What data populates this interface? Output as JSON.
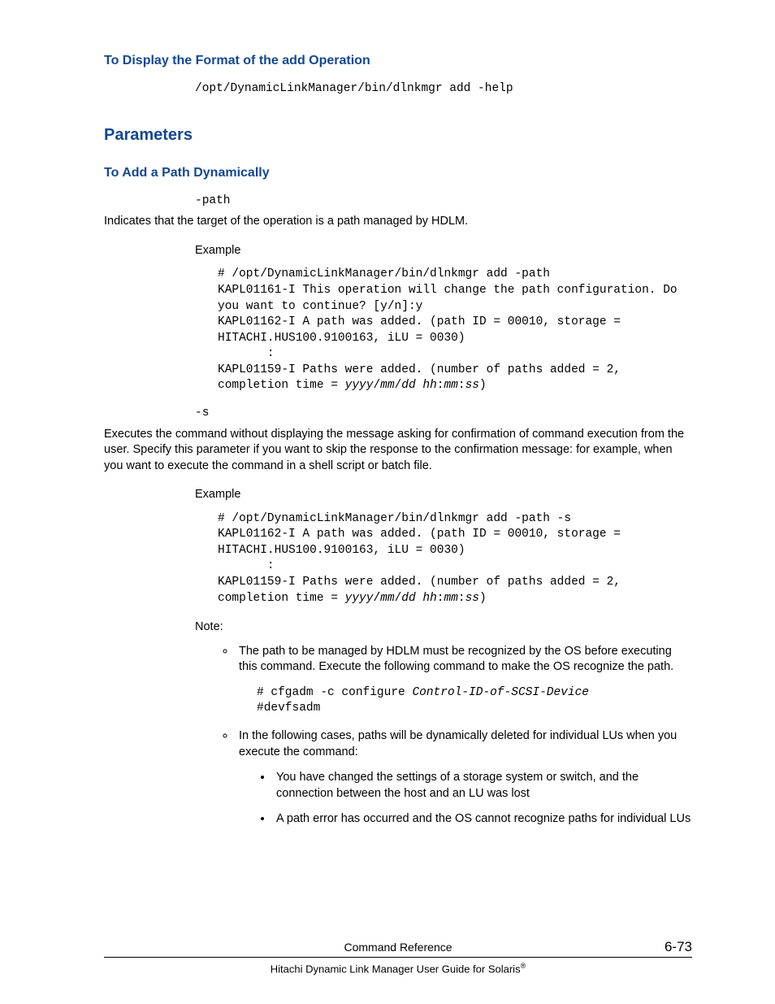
{
  "headings": {
    "h3_format": "To Display the Format of the add Operation",
    "h2_params": "Parameters",
    "h3_addpath": "To Add a Path Dynamically"
  },
  "code": {
    "help_cmd": "/opt/DynamicLinkManager/bin/dlnkmgr add -help",
    "path_term": "-path",
    "path_desc": "Indicates that the target of the operation is a path managed by HDLM.",
    "example_label": "Example",
    "ex1_l1": "# /opt/DynamicLinkManager/bin/dlnkmgr add -path",
    "ex1_l2": "KAPL01161-I This operation will change the path configuration. Do you want to continue? [y/n]:y",
    "ex1_l3": "KAPL01162-I A path was added. (path ID = 00010, storage = HITACHI.HUS100.9100163, iLU = 0030)",
    "ex1_l4": "       :",
    "ex1_l5a": "KAPL01159-I Paths were added. (number of paths added = 2, completion time = ",
    "ex1_l5b": "yyyy",
    "ex1_l5c": "/",
    "ex1_l5d": "mm",
    "ex1_l5e": "/",
    "ex1_l5f": "dd",
    "ex1_l5g": " ",
    "ex1_l5h": "hh",
    "ex1_l5i": ":",
    "ex1_l5j": "mm",
    "ex1_l5k": ":",
    "ex1_l5l": "ss",
    "ex1_l5m": ")",
    "s_term": "-s",
    "s_desc": "Executes the command without displaying the message asking for confirmation of command execution from the user. Specify this parameter if you want to skip the response to the confirmation message: for example, when you want to execute the command in a shell script or batch file.",
    "ex2_l1": "# /opt/DynamicLinkManager/bin/dlnkmgr add -path -s",
    "ex2_l2": "KAPL01162-I A path was added. (path ID = 00010, storage = HITACHI.HUS100.9100163, iLU = 0030)",
    "ex2_l3": "       :",
    "note_label": "Note:",
    "note1": "The path to be managed by HDLM must be recognized by the OS before executing this command. Execute the following command to make the OS recognize the path.",
    "note1_code_a": "# cfgadm -c configure ",
    "note1_code_b": "Control-ID-of-SCSI-Device",
    "note1_code_c": "#devfsadm",
    "note2": "In the following cases, paths will be dynamically deleted for individual LUs when you execute the command:",
    "note2_s1": "You have changed the settings of a storage system or switch, and the connection between the host and an LU was lost",
    "note2_s2": "A path error has occurred and the OS cannot recognize paths for individual LUs"
  },
  "footer": {
    "center": "Command Reference",
    "right": "6-73",
    "sub_a": "Hitachi Dynamic Link Manager User Guide for Solaris",
    "sub_b": "®"
  }
}
